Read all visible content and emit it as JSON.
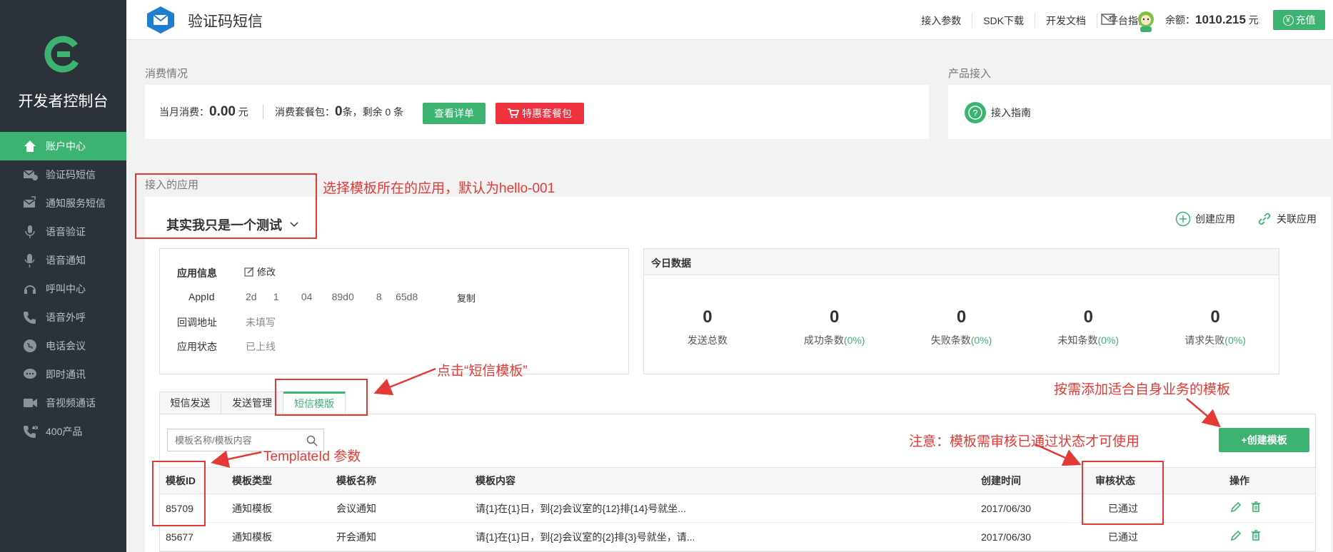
{
  "sidebar": {
    "title": "开发者控制台",
    "items": [
      {
        "label": "账户中心",
        "icon": "home-icon",
        "active": true
      },
      {
        "label": "验证码短信",
        "icon": "verify-sms-icon"
      },
      {
        "label": "通知服务短信",
        "icon": "notify-sms-icon"
      },
      {
        "label": "语音验证",
        "icon": "voice-verify-icon"
      },
      {
        "label": "语音通知",
        "icon": "voice-notify-icon"
      },
      {
        "label": "呼叫中心",
        "icon": "call-center-icon"
      },
      {
        "label": "语音外呼",
        "icon": "outbound-call-icon"
      },
      {
        "label": "电话会议",
        "icon": "conference-icon"
      },
      {
        "label": "即时通讯",
        "icon": "chat-icon"
      },
      {
        "label": "音视频通话",
        "icon": "video-call-icon"
      },
      {
        "label": "400产品",
        "icon": "phone-400-icon"
      }
    ]
  },
  "header": {
    "title": "验证码短信",
    "links": [
      "接入参数",
      "SDK下载",
      "开发文档",
      "平台指南"
    ],
    "balance_label": "余额：",
    "balance_value": "1010.215",
    "balance_unit": "元",
    "charge_label": "充值"
  },
  "consumption": {
    "section_label": "消费情况",
    "month_label": "当月消费：",
    "month_value": "0.00",
    "month_unit": "元",
    "package_label": "消费套餐包：",
    "package_value": "0",
    "package_rest": "条，剩余 0 条",
    "detail_button": "查看详单",
    "offer_button": "特惠套餐包"
  },
  "product": {
    "section_label": "产品接入",
    "guide_label": "接入指南"
  },
  "apps": {
    "section_label": "接入的应用",
    "selected_app": "其实我只是一个测试",
    "create_label": "创建应用",
    "link_label": "关联应用"
  },
  "app_info": {
    "title": "应用信息",
    "edit_label": "修改",
    "appid_label": "AppId",
    "appid_value": "2d      1        04       89d0        8     65d8",
    "copy_label": "复制",
    "callback_label": "回调地址",
    "callback_value": "未填写",
    "status_label": "应用状态",
    "status_value": "已上线"
  },
  "today": {
    "title": "今日数据",
    "stats": [
      {
        "value": "0",
        "label": "发送总数",
        "pct": ""
      },
      {
        "value": "0",
        "label": "成功条数",
        "pct": "(0%)"
      },
      {
        "value": "0",
        "label": "失败条数",
        "pct": "(0%)"
      },
      {
        "value": "0",
        "label": "未知条数",
        "pct": "(0%)"
      },
      {
        "value": "0",
        "label": "请求失败",
        "pct": "(0%)"
      }
    ]
  },
  "tabs": [
    "短信发送",
    "发送管理",
    "短信模版"
  ],
  "templates": {
    "search_placeholder": "模板名称/模板内容",
    "create_button": "+创建模板",
    "columns": [
      "模板ID",
      "模板类型",
      "模板名称",
      "模板内容",
      "创建时间",
      "审核状态",
      "操作"
    ],
    "rows": [
      {
        "id": "85709",
        "type": "通知模板",
        "name": "会议通知",
        "content": "请{1}在{1}日，到{2}会议室的{12}排{14}号就坐...",
        "date": "2017/06/30",
        "status": "已通过"
      },
      {
        "id": "85677",
        "type": "通知模板",
        "name": "开会通知",
        "content": "请{1}在{1}日，到{2}会议室的{2}排{3}号就坐，请...",
        "date": "2017/06/30",
        "status": "已通过"
      }
    ]
  },
  "annotations": {
    "select_app": "选择模板所在的应用，默认为hello-001",
    "click_tab": "点击“短信模板”",
    "add_template": "按需添加适合自身业务的模板",
    "notice": "注意：模板需审核已通过状态才可使用",
    "template_id": "TemplateId 参数"
  },
  "colors": {
    "accent": "#3cb371",
    "sidebar": "#2b323a",
    "danger": "#f0323e",
    "annotation": "#e53935"
  }
}
